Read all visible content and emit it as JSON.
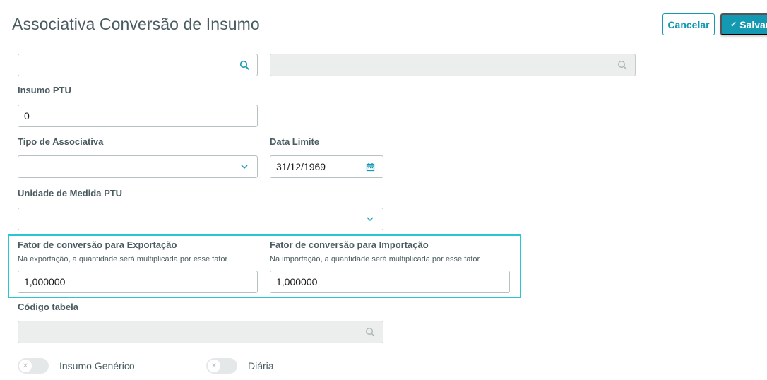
{
  "header": {
    "title": "Associativa Conversão de Insumo",
    "cancel_label": "Cancelar",
    "save_label": "Salvar"
  },
  "search": {
    "insumo_code_value": "",
    "insumo_desc_value": ""
  },
  "insumo_ptu": {
    "label": "Insumo PTU",
    "value": "0"
  },
  "tipo_associativa": {
    "label": "Tipo de Associativa",
    "value": ""
  },
  "data_limite": {
    "label": "Data Limite",
    "value": "31/12/1969"
  },
  "unidade_medida": {
    "label": "Unidade de Medida PTU",
    "value": ""
  },
  "fator_exportacao": {
    "label": "Fator de conversão para Exportação",
    "help": "Na exportação, a quantidade será multiplicada por esse fator",
    "value": "1,000000"
  },
  "fator_importacao": {
    "label": "Fator de conversão para Importação",
    "help": "Na importação, a quantidade será multiplicada por esse fator",
    "value": "1,000000"
  },
  "codigo_tabela": {
    "label": "Código tabela",
    "value": ""
  },
  "toggles": {
    "insumo_generico": "Insumo Genérico",
    "diaria": "Diária"
  },
  "colors": {
    "primary": "#1499b3",
    "highlight": "#29c5d3",
    "text": "#4a5c60",
    "disabled_bg": "#eceeee"
  }
}
